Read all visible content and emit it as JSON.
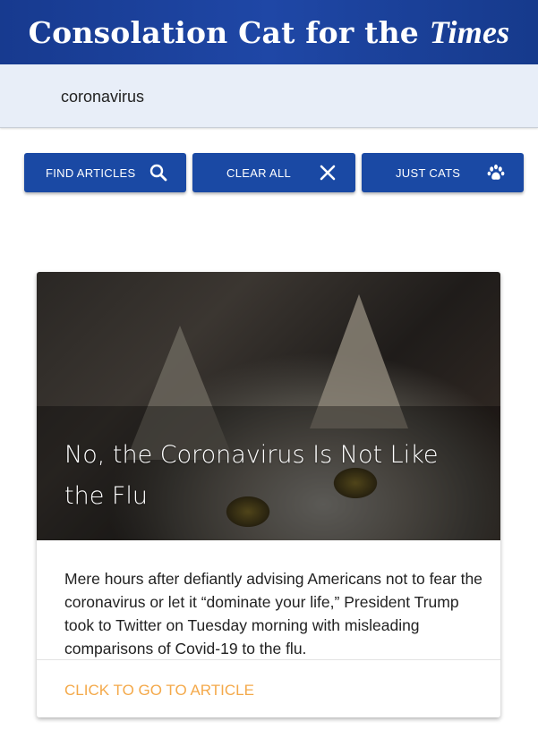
{
  "header": {
    "title": "Consolation Cat for the",
    "title_brand": "Times"
  },
  "search": {
    "value": "coronavirus",
    "placeholder": ""
  },
  "buttons": {
    "find_label": "FIND ARTICLES",
    "clear_label": "CLEAR ALL",
    "cats_label": "JUST CATS"
  },
  "icons": {
    "find": "search-icon",
    "clear": "close-icon",
    "cats": "paw-icon"
  },
  "article": {
    "title": "No, the Coronavirus Is Not Like the Flu",
    "summary": "Mere hours after defiantly advising Americans not to fear the coronavirus or let it “dominate your life,” President Trump took to Twitter on Tuesday morning with misleading comparisons of Covid-19 to the flu.",
    "link_label": "CLICK TO GO TO ARTICLE"
  },
  "colors": {
    "header": "#1f47a6",
    "button": "#1a49a4",
    "link": "#f4a94a",
    "search_bar": "#e8eef8"
  }
}
